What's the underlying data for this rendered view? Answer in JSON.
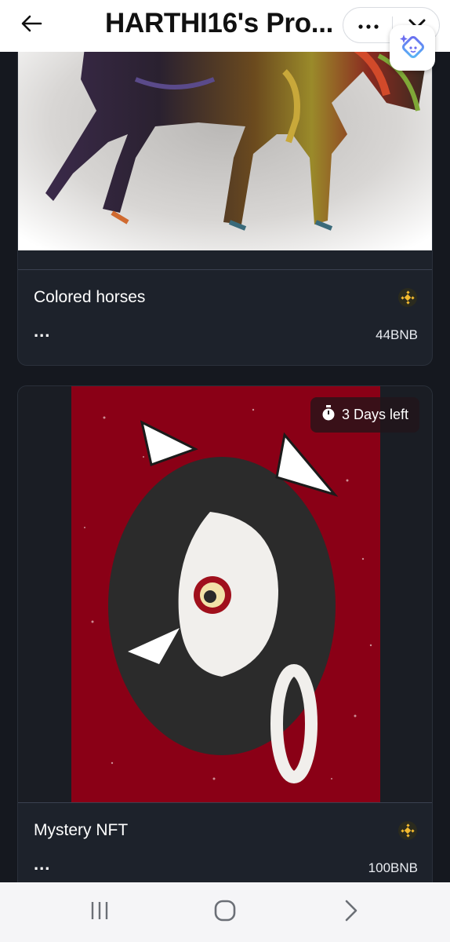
{
  "header": {
    "title": "HARTHI16's Pro...",
    "back_icon": "arrow-left-icon",
    "more_icon": "more-horizontal-icon",
    "collapse_icon": "chevron-down-icon",
    "assistant_icon": "sparkle-assistant-icon"
  },
  "colors": {
    "background": "#15181f",
    "card": "#1d222b",
    "bnb_gold": "#f3ba2f"
  },
  "nfts": [
    {
      "name": "Colored horses",
      "more": "...",
      "price": "44BNB",
      "chain_icon": "bnb-icon"
    },
    {
      "name": "Mystery NFT",
      "more": "...",
      "price": "100BNB",
      "chain_icon": "bnb-icon",
      "timer_icon": "stopwatch-icon",
      "timer_text": "3 Days left"
    }
  ],
  "system_nav": {
    "recents_icon": "recents-icon",
    "home_icon": "home-icon",
    "back_icon": "back-chevron-icon"
  }
}
